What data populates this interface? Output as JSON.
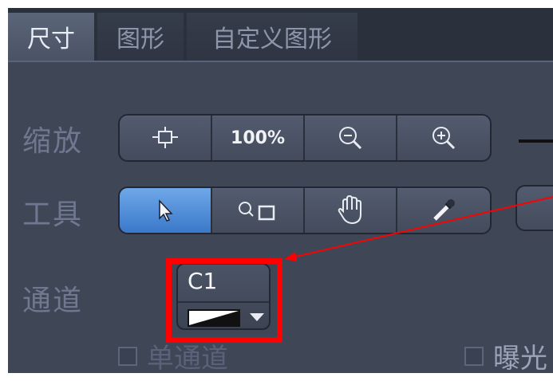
{
  "tabs": [
    {
      "label": "尺寸",
      "active": true
    },
    {
      "label": "图形",
      "active": false
    },
    {
      "label": "自定义图形",
      "active": false
    }
  ],
  "rows": {
    "zoom_label": "缩放",
    "tools_label": "工具",
    "channel_label": "通道"
  },
  "zoom_buttons": [
    {
      "icon": "fit-frame-icon"
    },
    {
      "label": "100%"
    },
    {
      "icon": "zoom-out-icon"
    },
    {
      "icon": "zoom-in-icon"
    }
  ],
  "tool_buttons": [
    {
      "icon": "arrow-pointer-icon",
      "active": true
    },
    {
      "icon": "zoom-rect-icon"
    },
    {
      "icon": "hand-pan-icon"
    },
    {
      "icon": "eyedropper-icon"
    }
  ],
  "channel": {
    "name": "C1"
  },
  "checkboxes": {
    "single_channel": "单通道",
    "exposure": "曝光"
  },
  "colors": {
    "panel_bg": "#3f4656",
    "active_button": "#3a78c9",
    "highlight": "#ff0000"
  }
}
